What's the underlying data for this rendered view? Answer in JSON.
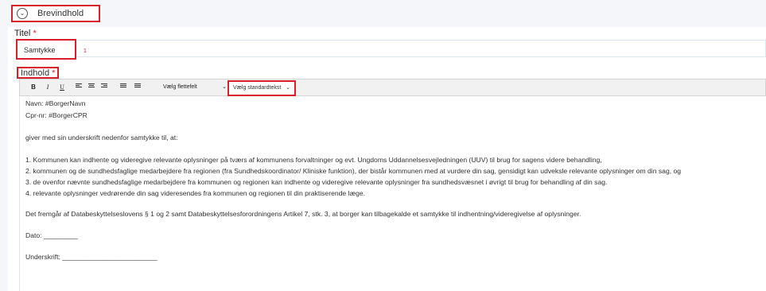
{
  "section": {
    "title": "Brevindhold",
    "toggle_icon": "chevron-circle-down-icon"
  },
  "title_field": {
    "label": "Titel",
    "required_mark": "*",
    "value": "Samtykke",
    "counter": "1"
  },
  "content_field": {
    "label": "Indhold",
    "required_mark": "*"
  },
  "toolbar": {
    "bold": "B",
    "italic": "I",
    "underline": "U",
    "merge_field_select": "Vælg flettefelt",
    "standard_text_select": "Vælg standardtekst"
  },
  "editor": {
    "lines": [
      "Navn: #BorgerNavn",
      "Cpr-nr: #BorgerCPR",
      "giver med sin underskrift nedenfor samtykke til, at:",
      "1. Kommunen kan indhente og videregive relevante oplysninger på tværs af kommunens forvaltninger og evt. Ungdoms Uddannelsesvejledningen (UUV) til brug for sagens videre behandling,",
      "2. kommunen og de sundhedsfaglige medarbejdere fra regionen (fra Sundhedskoordinator/ Kliniske funktion), der bistår kommunen med at vurdere din sag, gensidigt kan udveksle relevante oplysninger om din sag, og",
      "3. de ovenfor nævnte sundhedsfaglige medarbejdere fra kommunen og regionen kan indhente og videregive relevante oplysninger fra sundhedsvæsnet i øvrigt til brug for behandling af din sag.",
      "4. relevante oplysninger vedrørende din sag videresendes fra kommunen og regionen til din praktiserende læge.",
      "Det fremgår af Databeskyttelseslovens § 1 og 2 samt Databeskyttelsesforordningens Artikel 7, stk. 3, at borger kan tilbagekalde et samtykke til indhentning/videregivelse af oplysninger.",
      "Dato: _________",
      "Underskrift: _________________________"
    ]
  }
}
